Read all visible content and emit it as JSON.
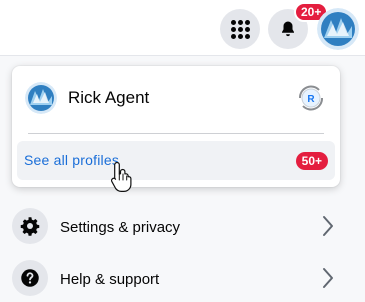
{
  "topbar": {
    "notification_badge": "20+",
    "icons": [
      "menu-grid-icon",
      "bell-icon",
      "account-avatar"
    ]
  },
  "profiles": {
    "current_profile_name": "Rick Agent",
    "switch_profile_initial": "R",
    "see_all_label": "See all profiles",
    "see_all_badge": "50+"
  },
  "menu": {
    "items": [
      {
        "label": "Settings & privacy",
        "icon": "gear-icon"
      },
      {
        "label": "Help & support",
        "icon": "question-icon"
      }
    ]
  },
  "colors": {
    "badge_red": "#e41e3f",
    "link_blue": "#1a6ed8",
    "icon_circle_grey": "#e4e6eb"
  }
}
